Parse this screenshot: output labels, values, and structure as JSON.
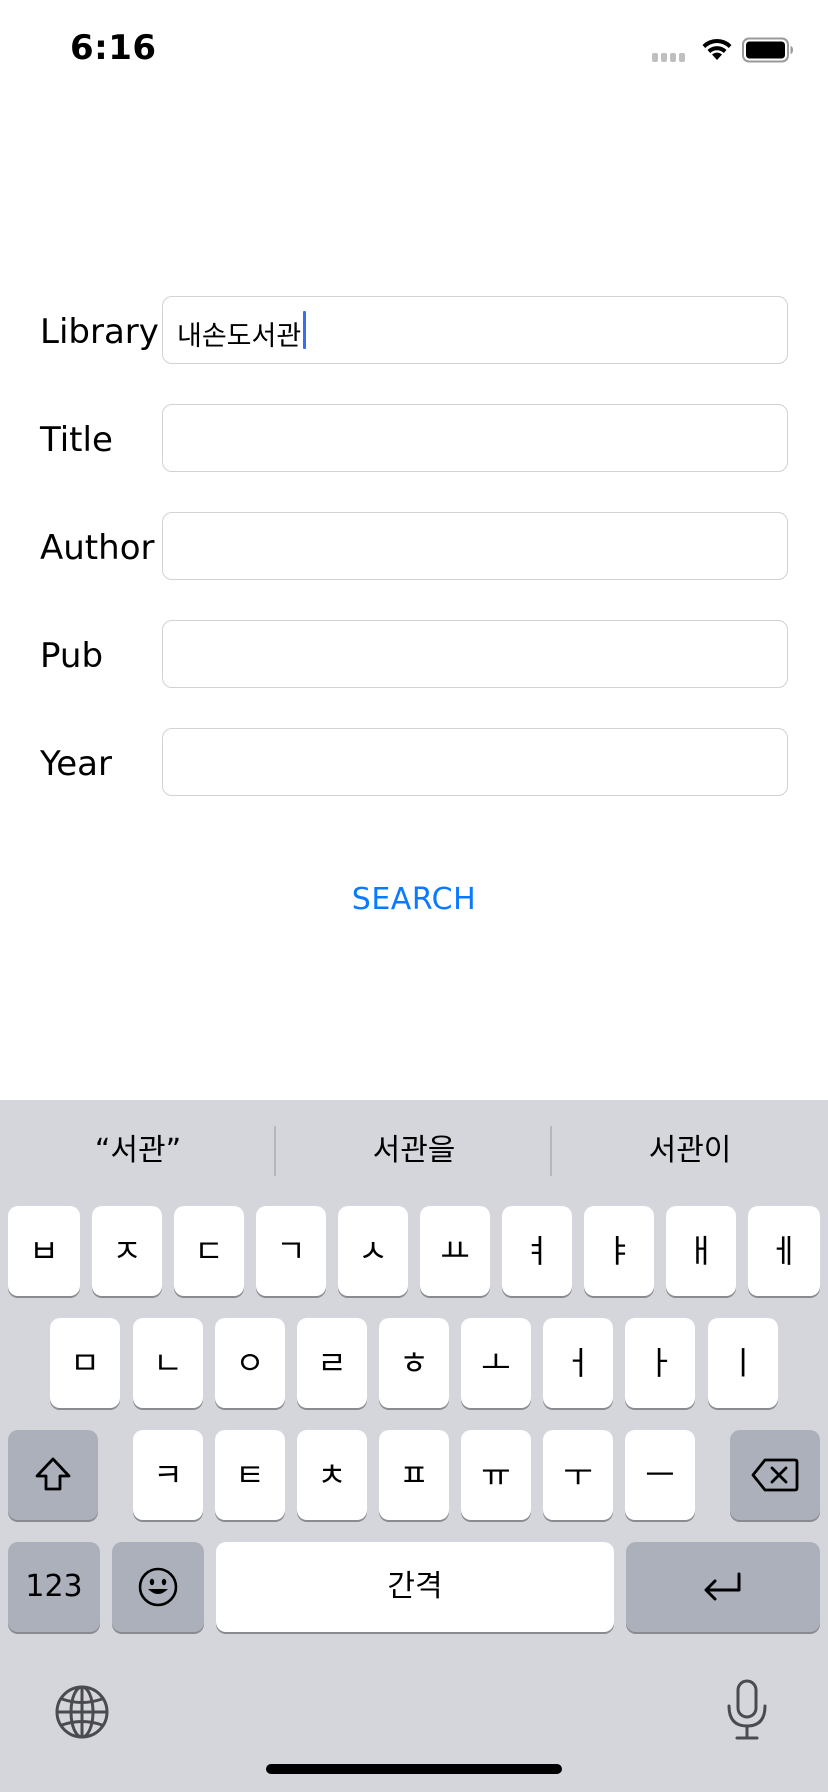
{
  "status": {
    "time": "6:16"
  },
  "form": {
    "library_label": "Library",
    "library_value": "내손도서관",
    "title_label": "Title",
    "title_value": "",
    "author_label": "Author",
    "author_value": "",
    "pub_label": "Pub",
    "pub_value": "",
    "year_label": "Year",
    "year_value": "",
    "search_label": "SEARCH",
    "accent_color": "#0a7aff"
  },
  "keyboard": {
    "suggestions": [
      "“서관”",
      "서관을",
      "서관이"
    ],
    "row1": [
      "ㅂ",
      "ㅈ",
      "ㄷ",
      "ㄱ",
      "ㅅ",
      "ㅛ",
      "ㅕ",
      "ㅑ",
      "ㅐ",
      "ㅔ"
    ],
    "row2": [
      "ㅁ",
      "ㄴ",
      "ㅇ",
      "ㄹ",
      "ㅎ",
      "ㅗ",
      "ㅓ",
      "ㅏ",
      "ㅣ"
    ],
    "row3": [
      "ㅋ",
      "ㅌ",
      "ㅊ",
      "ㅍ",
      "ㅠ",
      "ㅜ",
      "ㅡ"
    ],
    "numbers_label": "123",
    "space_label": "간격",
    "icons": {
      "shift": "shift-icon",
      "delete": "delete-icon",
      "emoji": "emoji-icon",
      "return": "return-icon",
      "globe": "globe-icon",
      "mic": "microphone-icon"
    }
  }
}
